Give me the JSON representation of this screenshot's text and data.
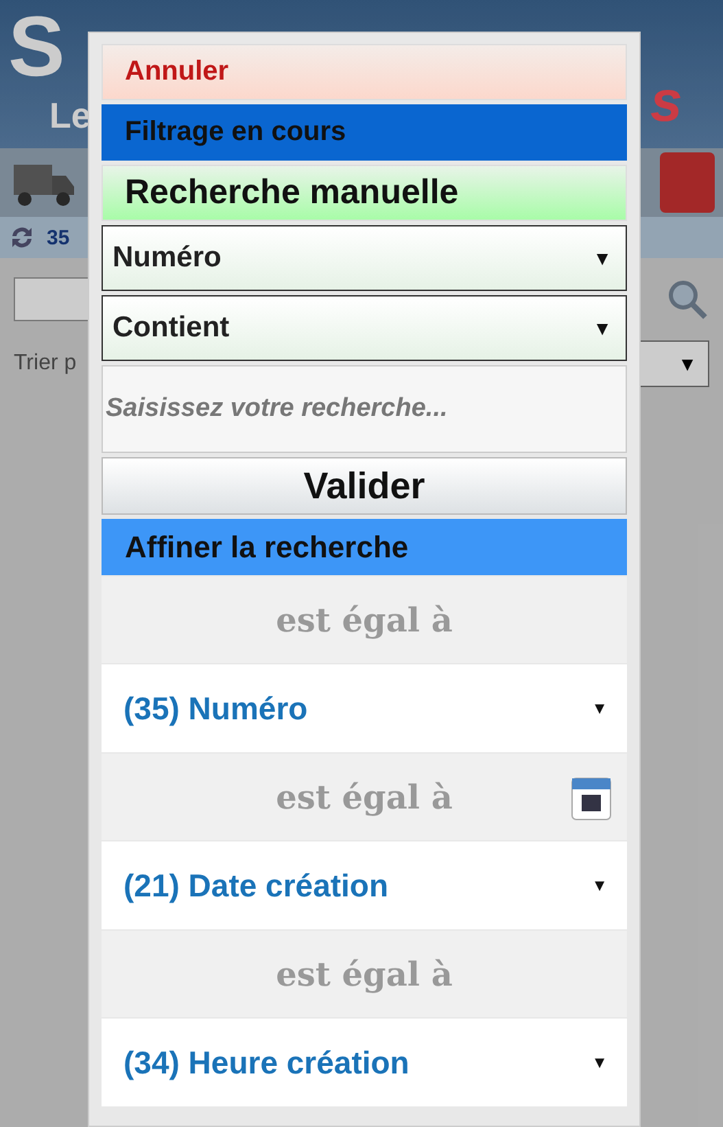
{
  "background": {
    "logo_texts": [
      "S",
      "Le",
      "s"
    ],
    "count": "35",
    "sort_label": "Trier p",
    "sort_arrow": "▼"
  },
  "dialog": {
    "cancel": "Annuler",
    "status": "Filtrage en cours",
    "heading": "Recherche manuelle",
    "field_select": {
      "value": "Numéro",
      "arrow": "▼"
    },
    "operator_select": {
      "value": "Contient",
      "arrow": "▼"
    },
    "search": {
      "placeholder": "Saisissez votre recherche..."
    },
    "submit": "Valider",
    "refine_heading": "Affiner la recherche",
    "filters": [
      {
        "kind": "text",
        "operator": "est égal à",
        "field": "(35) Numéro",
        "arrow": "▼"
      },
      {
        "kind": "date",
        "operator": "est égal à",
        "field": "(21) Date création",
        "arrow": "▼"
      },
      {
        "kind": "text",
        "operator": "est égal à",
        "field": "(34) Heure création",
        "arrow": "▼"
      }
    ]
  }
}
